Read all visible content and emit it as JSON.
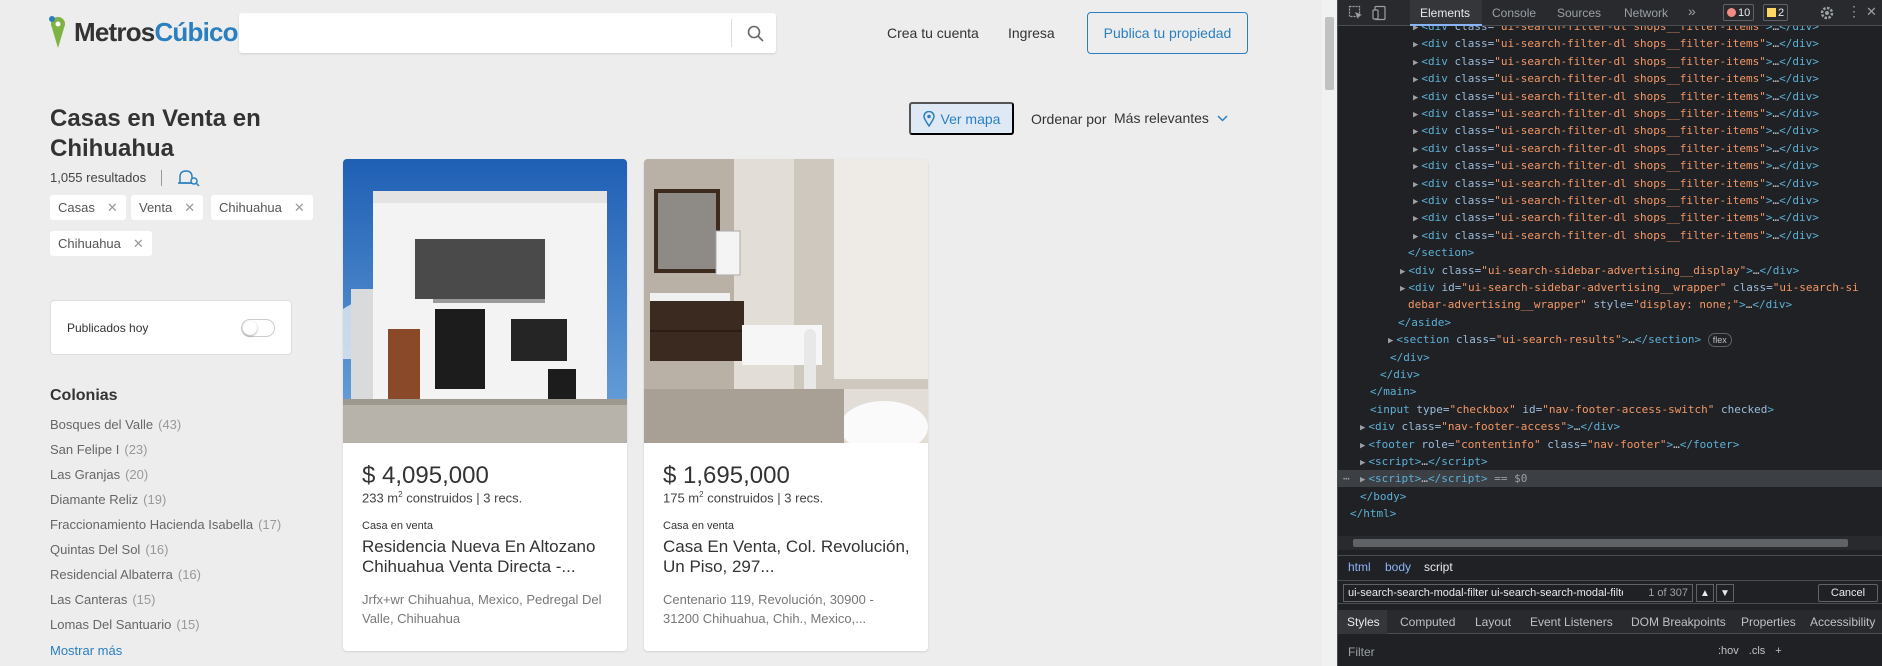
{
  "header": {
    "logo_primary": "Metros",
    "logo_secondary": "Cúbicos",
    "search_value": "",
    "create_account": "Crea tu cuenta",
    "login": "Ingresa",
    "publish": "Publica tu propiedad"
  },
  "listing": {
    "title": "Casas en Venta en Chihuahua",
    "results": "1,055 resultados",
    "chips": [
      "Casas",
      "Venta",
      "Chihuahua",
      "Chihuahua"
    ],
    "published_today": "Publicados hoy",
    "published_today_on": false,
    "colonias_title": "Colonias",
    "colonias": [
      {
        "name": "Bosques del Valle",
        "count": "(43)"
      },
      {
        "name": "San Felipe I",
        "count": "(23)"
      },
      {
        "name": "Las Granjas",
        "count": "(20)"
      },
      {
        "name": "Diamante Reliz",
        "count": "(19)"
      },
      {
        "name": "Fraccionamiento Hacienda Isabella",
        "count": "(17)"
      },
      {
        "name": "Quintas Del Sol",
        "count": "(16)"
      },
      {
        "name": "Residencial Albaterra",
        "count": "(16)"
      },
      {
        "name": "Las Canteras",
        "count": "(15)"
      },
      {
        "name": "Lomas Del Santuario",
        "count": "(15)"
      }
    ],
    "show_more": "Mostrar más",
    "map_button": "Ver mapa",
    "sort_label": "Ordenar por",
    "sort_value": "Más relevantes",
    "cards": [
      {
        "price": "$ 4,095,000",
        "area": "233 m",
        "area_sup": "2",
        "specs": " construidos | 3 recs.",
        "kind": "Casa en venta",
        "name": "Residencia Nueva En Altozano Chihuahua Venta Directa -...",
        "address": "Jrfx+wr Chihuahua, Mexico, Pedregal Del Valle, Chihuahua"
      },
      {
        "price": "$ 1,695,000",
        "area": "175 m",
        "area_sup": "2",
        "specs": " construidos | 3 recs.",
        "kind": "Casa en venta",
        "name": "Casa En Venta, Col. Revolución, Un Piso, 297...",
        "address": "Centenario 119, Revolución, 30900 - 31200 Chihuahua, Chih., Mexico,..."
      }
    ]
  },
  "devtools": {
    "tabs": [
      "Elements",
      "Console",
      "Sources",
      "Network"
    ],
    "more_tabs": "»",
    "errors": "10",
    "warnings": "2",
    "filter_item": "ui-search-filter-dl shops__filter-items",
    "filter_item_count": 13,
    "dom": {
      "section_close": "</section>",
      "adv_display_class": "ui-search-sidebar-advertising__display",
      "adv_wrapper_id": "ui-search-sidebar-advertising__wrapper",
      "adv_wrapper_class_part1": "ui-search-si",
      "adv_wrapper_class_part2": "debar-advertising__wrapper",
      "adv_wrapper_style": "display: none;",
      "aside_close": "</aside>",
      "results_class": "ui-search-results",
      "flex_badge": "flex",
      "div_close": "</div>",
      "main_close": "</main>",
      "input_type": "checkbox",
      "input_id": "nav-footer-access-switch",
      "input_attr": "checked",
      "footer_access_class": "nav-footer-access",
      "footer_role": "contentinfo",
      "footer_class": "nav-footer",
      "script_tag": "script",
      "selected_marker": "== $0",
      "body_close": "</body>",
      "html_close": "</html>"
    },
    "breadcrumbs": [
      "html",
      "body",
      "script"
    ],
    "find_query": "ui-search-search-modal-filter ui-search-search-modal-filter--m",
    "find_count": "1 of 307",
    "find_cancel": "Cancel",
    "bottom_tabs": [
      "Styles",
      "Computed",
      "Layout",
      "Event Listeners",
      "DOM Breakpoints",
      "Properties",
      "Accessibility"
    ],
    "filter_placeholder": "Filter",
    "filter_tools": [
      ":hov",
      ".cls",
      "+"
    ]
  },
  "colors": {
    "brand_blue": "#2a7fc1",
    "logo_green": "#7cb342",
    "devtools_bg": "#202124"
  }
}
